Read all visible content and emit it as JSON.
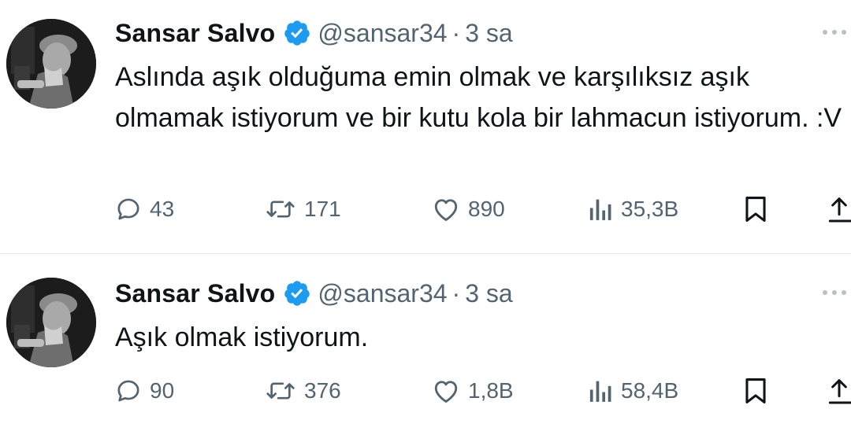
{
  "colors": {
    "text": "#0f1419",
    "muted": "#536471",
    "verified": "#1d9bf0",
    "divider": "#e7e9ea"
  },
  "icons": [
    "avatar-photo",
    "verified-badge-icon",
    "more-icon",
    "reply-icon",
    "repost-icon",
    "like-icon",
    "views-icon",
    "bookmark-icon",
    "share-icon"
  ],
  "tweets": [
    {
      "author": {
        "name": "Sansar Salvo",
        "handle": "@sansar34",
        "verified": true
      },
      "separator": "·",
      "time": "3 sa",
      "text": "Aslında aşık olduğuma emin olmak ve karşılıksız aşık olmamak istiyorum ve bir kutu kola bir lahmacun istiyorum. :V",
      "stats": {
        "replies": "43",
        "reposts": "171",
        "likes": "890",
        "views": "35,3B"
      }
    },
    {
      "author": {
        "name": "Sansar Salvo",
        "handle": "@sansar34",
        "verified": true
      },
      "separator": "·",
      "time": "3 sa",
      "text": "Aşık olmak istiyorum.",
      "stats": {
        "replies": "90",
        "reposts": "376",
        "likes": "1,8B",
        "views": "58,4B"
      }
    }
  ]
}
